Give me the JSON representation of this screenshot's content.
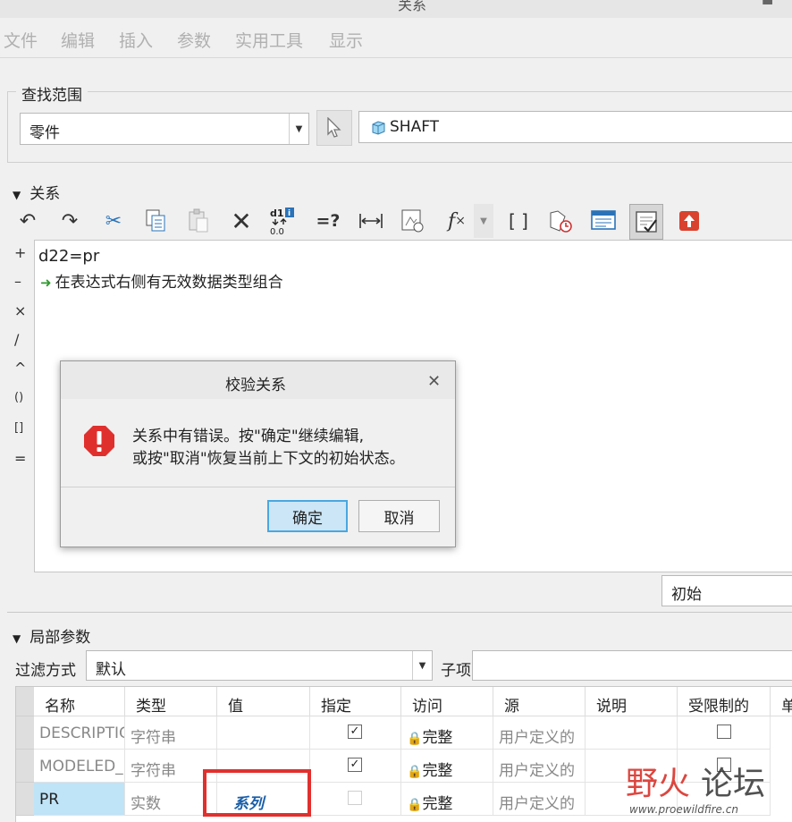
{
  "window": {
    "title": "关系"
  },
  "menu": {
    "items": [
      "文件",
      "编辑",
      "插入",
      "参数",
      "实用工具",
      "显示"
    ]
  },
  "find_scope": {
    "legend": "查找范围",
    "scope_value": "零件",
    "model_name": "SHAFT"
  },
  "relations": {
    "header": "关系",
    "editor_lines": [
      "d22=pr",
      "在表达式右侧有无效数据类型组合"
    ],
    "side_ops": [
      "+",
      "–",
      "×",
      "/",
      "^",
      "()",
      "[]",
      "="
    ],
    "units_value": "初始"
  },
  "dialog": {
    "title": "校验关系",
    "message_line1": "关系中有错误。按\"确定\"继续编辑,",
    "message_line2": "或按\"取消\"恢复当前上下文的初始状态。",
    "ok_label": "确定",
    "cancel_label": "取消"
  },
  "local_params": {
    "header": "局部参数",
    "filter_label": "过滤方式",
    "filter_value": "默认",
    "subitem_label": "子项",
    "columns": [
      "名称",
      "类型",
      "值",
      "指定",
      "访问",
      "源",
      "说明",
      "受限制的",
      "单"
    ],
    "rows": [
      {
        "name": "DESCRIPTIO",
        "type": "字符串",
        "value": "",
        "designate": true,
        "access": "完整",
        "source": "用户定义的"
      },
      {
        "name": "MODELED_",
        "type": "字符串",
        "value": "",
        "designate": true,
        "access": "完整",
        "source": "用户定义的"
      },
      {
        "name": "PR",
        "type": "实数",
        "value": "系列",
        "designate": false,
        "access": "完整",
        "source": "用户定义的"
      }
    ]
  },
  "watermark": {
    "text": "野火论坛",
    "url": "www.proewildfire.cn"
  },
  "colors": {
    "error_red": "#e0302e",
    "ok_blue": "#4aa7e0",
    "selection": "#bfe3f7",
    "value_link": "#1a5ea8"
  }
}
